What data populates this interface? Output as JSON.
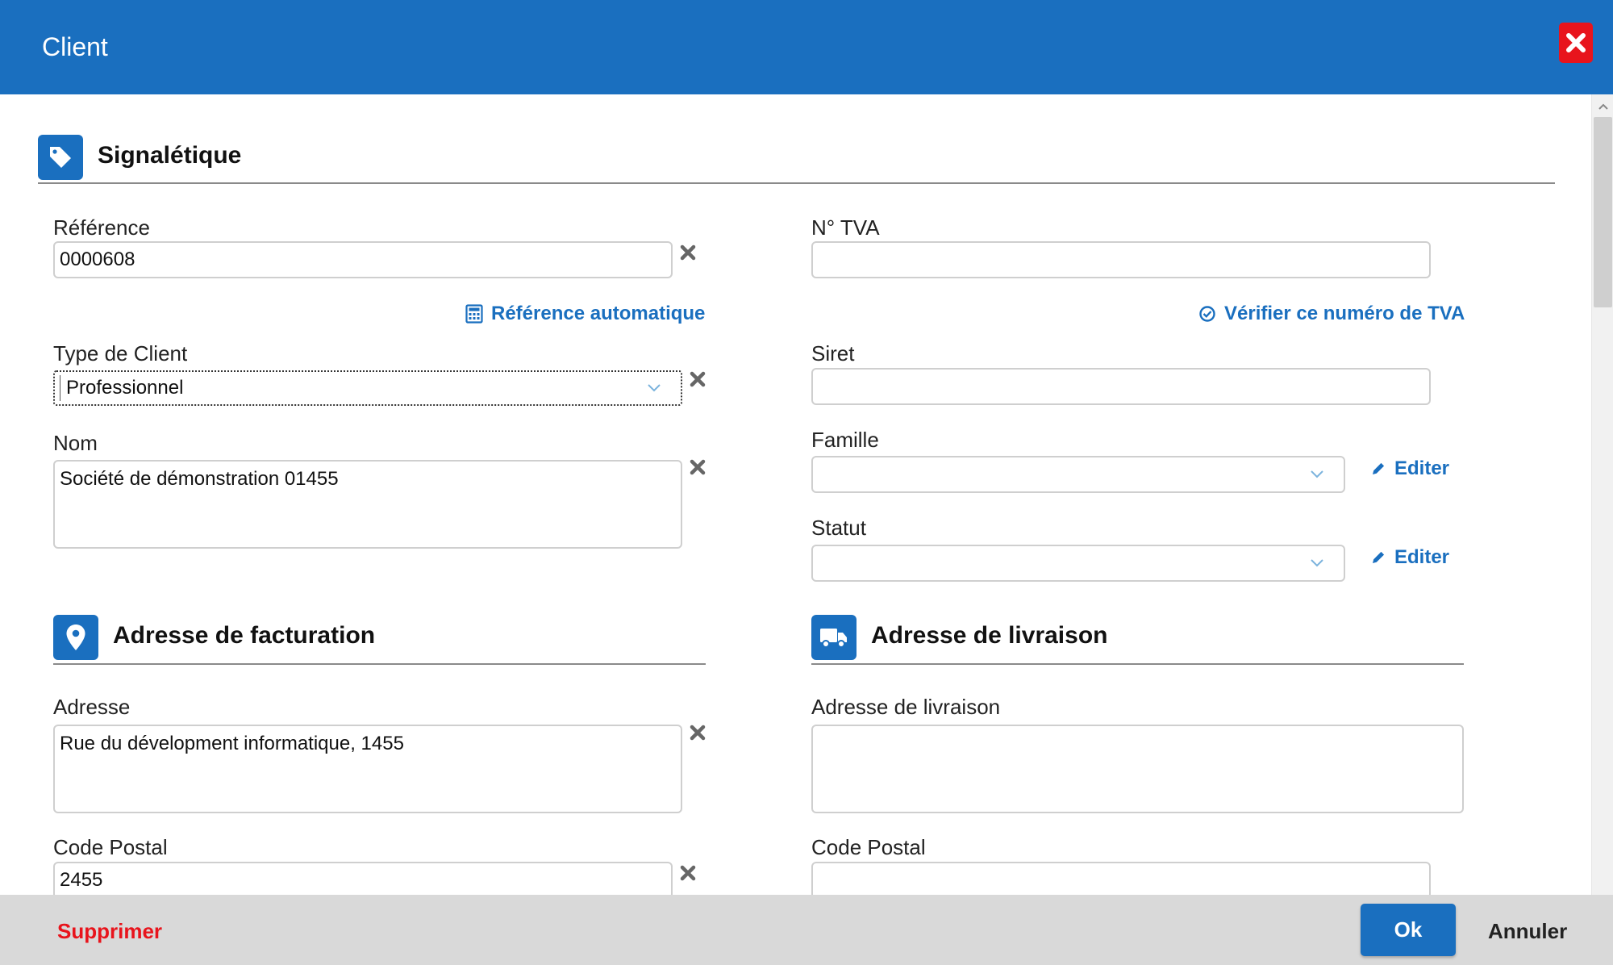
{
  "dialog": {
    "title": "Client",
    "close_icon": "close-icon"
  },
  "colors": {
    "primary": "#1a6fbf",
    "danger": "#e8141c",
    "footer_bg": "#d9d9d9"
  },
  "signaletique": {
    "title": "Signalétique",
    "icon": "tag-icon",
    "reference": {
      "label": "Référence",
      "value": "0000608"
    },
    "auto_reference_link": "Référence automatique",
    "type_client": {
      "label": "Type de Client",
      "value": "Professionnel"
    },
    "nom": {
      "label": "Nom",
      "value": "Société de démonstration 01455"
    },
    "tva": {
      "label": "N° TVA",
      "value": ""
    },
    "verify_tva_link": "Vérifier ce numéro de TVA",
    "siret": {
      "label": "Siret",
      "value": ""
    },
    "famille": {
      "label": "Famille",
      "value": "",
      "edit_label": "Editer"
    },
    "statut": {
      "label": "Statut",
      "value": "",
      "edit_label": "Editer"
    }
  },
  "billing": {
    "title": "Adresse de facturation",
    "icon": "map-marker-icon",
    "adresse": {
      "label": "Adresse",
      "value": "Rue du dévelopment informatique, 1455"
    },
    "code_postal": {
      "label": "Code Postal",
      "value": "2455"
    }
  },
  "delivery": {
    "title": "Adresse de livraison",
    "icon": "truck-icon",
    "adresse": {
      "label": "Adresse de livraison",
      "value": ""
    },
    "code_postal": {
      "label": "Code Postal",
      "value": ""
    }
  },
  "footer": {
    "delete_label": "Supprimer",
    "ok_label": "Ok",
    "cancel_label": "Annuler"
  }
}
